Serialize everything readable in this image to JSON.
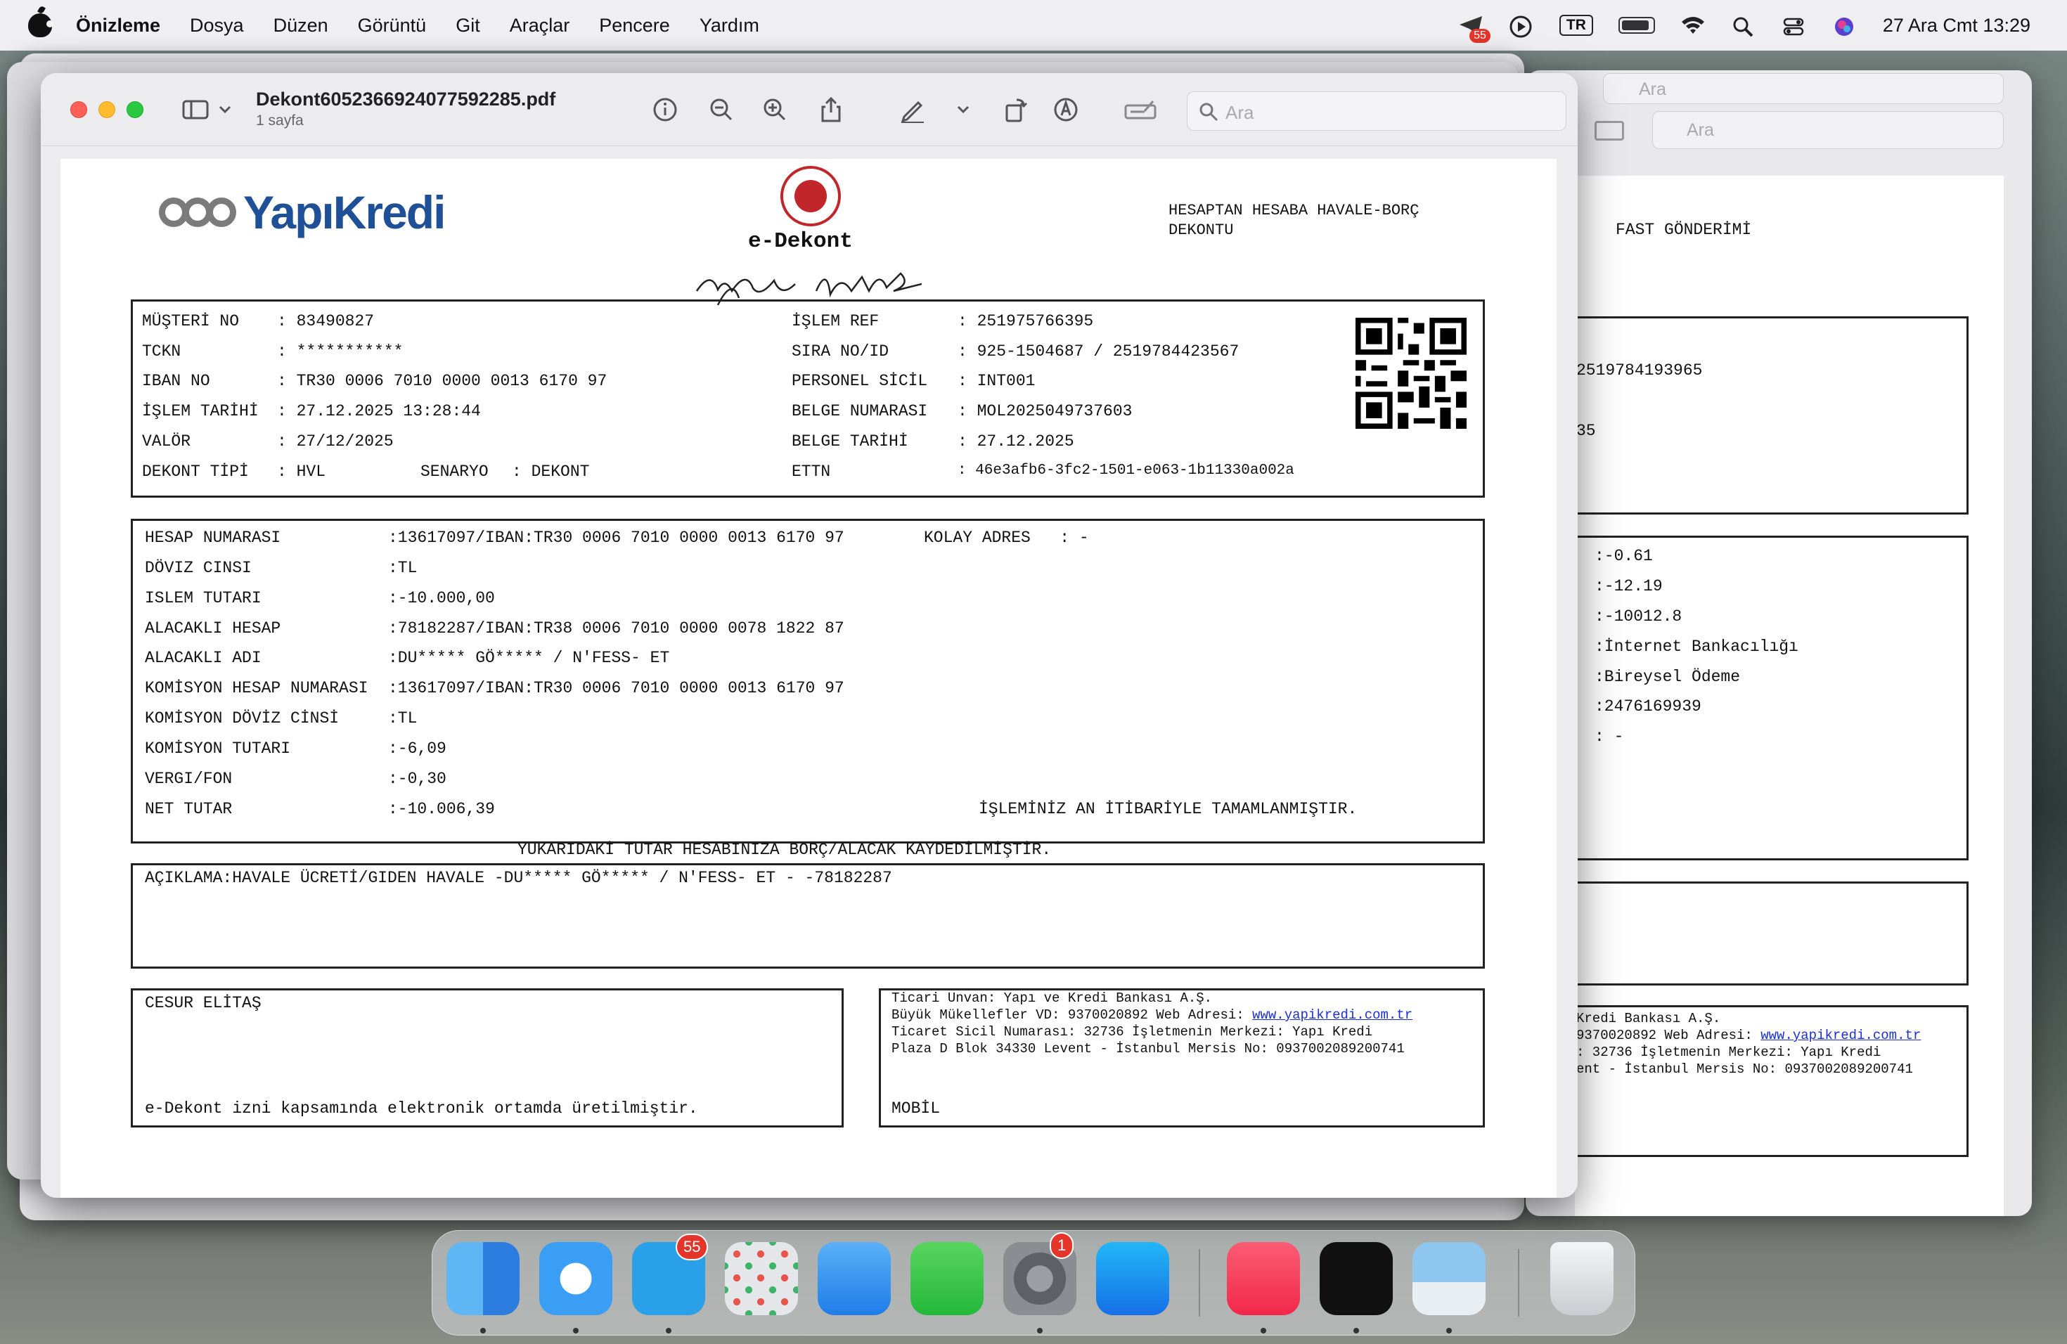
{
  "menubar": {
    "app_name": "Önizleme",
    "items": [
      "Dosya",
      "Düzen",
      "Görüntü",
      "Git",
      "Araçlar",
      "Pencere",
      "Yardım"
    ],
    "badge_count": "55",
    "input_source": "TR",
    "clock": "27 Ara Cmt  13:29"
  },
  "window": {
    "filename": "Dekont6052366924077592285.pdf",
    "page_count": "1 sayfa",
    "search_placeholder": "Ara"
  },
  "bg_window": {
    "search_placeholder": "Ara",
    "top_search_placeholder": "Ara",
    "title": "FAST GÖNDERİMİ",
    "ref": "2519784193965",
    "partial_35": "35",
    "values": [
      ":-0.61",
      ":-12.19",
      ":-10012.8",
      ":İnternet Bankacılığı",
      ":Bireysel Ödeme",
      ":2476169939",
      ": -"
    ],
    "footer": [
      "Kredi Bankası A.Ş.",
      "9370020892 Web Adresi: ",
      ": 32736 İşletmenin Merkezi: Yapı Kredi",
      "ent - İstanbul Mersis No: 0937002089200741"
    ],
    "footer_link": "www.yapikredi.com.tr"
  },
  "receipt": {
    "logo_text": "YapıKredi",
    "seal_label": "e-Dekont",
    "doc_title": "HESAPTAN HESABA HAVALE-BORÇ\nDEKONTU",
    "header_left": [
      {
        "label": "MÜŞTERİ NO",
        "value": ": 83490827"
      },
      {
        "label": "TCKN",
        "value": ": ***********"
      },
      {
        "label": "IBAN NO",
        "value": ": TR30 0006 7010 0000 0013 6170 97"
      },
      {
        "label": "İŞLEM TARİHİ",
        "value": ": 27.12.2025 13:28:44"
      },
      {
        "label": "VALÖR",
        "value": ": 27/12/2025"
      },
      {
        "label": "DEKONT TİPİ",
        "value": ": HVL"
      }
    ],
    "senaryo_label": "SENARYO",
    "senaryo_value": ": DEKONT",
    "header_right": [
      {
        "label": "İŞLEM REF",
        "value": ": 251975766395"
      },
      {
        "label": "SIRA NO/ID",
        "value": ": 925-1504687 / 2519784423567"
      },
      {
        "label": "PERSONEL SİCİL",
        "value": ": INT001"
      },
      {
        "label": "BELGE NUMARASI",
        "value": ": MOL2025049737603"
      },
      {
        "label": "BELGE TARİHİ",
        "value": ": 27.12.2025"
      },
      {
        "label": "ETTN",
        "value": ": 46e3afb6-3fc2-1501-e063-1b11330a002a"
      }
    ],
    "details": [
      {
        "label": "HESAP NUMARASI",
        "value": ":13617097/IBAN:TR30 0006 7010 0000 0013 6170 97"
      },
      {
        "label": "DÖVIZ CINSI",
        "value": ":TL"
      },
      {
        "label": "ISLEM TUTARI",
        "value": ":-10.000,00"
      },
      {
        "label": "ALACAKLI HESAP",
        "value": ":78182287/IBAN:TR38 0006 7010 0000 0078 1822 87"
      },
      {
        "label": "ALACAKLI ADI",
        "value": ":DU***** GÖ***** / N'FESS- ET"
      },
      {
        "label": "KOMİSYON HESAP NUMARASI",
        "value": ":13617097/IBAN:TR30 0006 7010 0000 0013 6170 97"
      },
      {
        "label": "KOMİSYON DÖVİZ CİNSİ",
        "value": ":TL"
      },
      {
        "label": "KOMİSYON TUTARI",
        "value": ":-6,09"
      },
      {
        "label": "VERGI/FON",
        "value": ":-0,30"
      },
      {
        "label": "NET TUTAR",
        "value": ":-10.006,39"
      }
    ],
    "kolay_adres": "KOLAY ADRES   : -",
    "completed_note": "İŞLEMİNİZ AN İTİBARİYLE TAMAMLANMIŞTIR.",
    "booked_note": "YUKARIDAKİ TUTAR HESABINIZA BORÇ/ALACAK KAYDEDİLMİŞTİR.",
    "description": "AÇIKLAMA:HAVALE ÜCRETİ/GIDEN HAVALE -DU***** GÖ***** / N'FESS- ET - -78182287",
    "signer": "CESUR ELİTAŞ",
    "electronic_note": "e-Dekont izni kapsamında elektronik ortamda üretilmiştir.",
    "bank_info": [
      "Ticari Unvan: Yapı ve Kredi Bankası A.Ş.",
      "Büyük Mükellefler VD: 9370020892 Web Adresi: ",
      "Ticaret Sicil Numarası: 32736 İşletmenin Merkezi: Yapı Kredi",
      "Plaza D Blok 34330 Levent - İstanbul Mersis No: 0937002089200741"
    ],
    "bank_link": "www.yapikredi.com.tr",
    "channel": "MOBİL"
  },
  "dock": {
    "apps": [
      "Finder",
      "Safari",
      "Telegram",
      "Launchpad",
      "Mail",
      "FaceTime",
      "System Settings",
      "App Store",
      "Music",
      "Screenshot",
      "Preview",
      "Trash"
    ],
    "telegram_badge": "55",
    "settings_badge": "1"
  }
}
